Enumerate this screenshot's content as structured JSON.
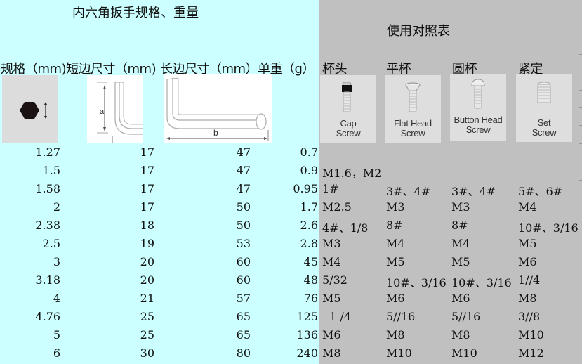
{
  "title": "内六角扳手规格、重量",
  "subtitle": "使用对照表",
  "headers": {
    "spec": "规格（mm)",
    "short": "短边尺寸（mm)",
    "long": "长边尺寸（mm）",
    "weight": "单重（g）",
    "cap": "杯头",
    "flat": "平杯",
    "button": "圆杯",
    "set": "紧定"
  },
  "illustrations": {
    "hex": "hex-key-cross-section",
    "short": {
      "label": "a"
    },
    "long": {
      "label": "b"
    },
    "cap": {
      "line1": "Cap",
      "line2": "Screw"
    },
    "flat": {
      "line1": "Flat Head",
      "line2": "Screw"
    },
    "button": {
      "line1": "Button Head",
      "line2": "Screw"
    },
    "set": {
      "line1": "Set",
      "line2": "Screw"
    }
  },
  "colors": {
    "left_bg": "#CCFFFF",
    "right_bg": "#C0C0C0"
  },
  "rows": [
    {
      "spec": "1.27",
      "short": "17",
      "long": "47",
      "weight": "0.7",
      "cap": "",
      "flat": "",
      "button": "",
      "set": ""
    },
    {
      "spec": "1.5",
      "short": "17",
      "long": "47",
      "weight": "0.9",
      "cap": "M1.6，M2",
      "flat": "",
      "button": "",
      "set": ""
    },
    {
      "spec": "1.58",
      "short": "17",
      "long": "47",
      "weight": "0.95",
      "cap": "1#",
      "flat": "3#、4#",
      "button": "3#、4#",
      "set": "5#、6#"
    },
    {
      "spec": "2",
      "short": "17",
      "long": "50",
      "weight": "1.7",
      "cap": "M2.5",
      "flat": "M3",
      "button": "M3",
      "set": "M4"
    },
    {
      "spec": "2.38",
      "short": "18",
      "long": "50",
      "weight": "2.6",
      "cap": "4#、1/8",
      "flat": "8#",
      "button": "8#",
      "set": "10#、3/16"
    },
    {
      "spec": "2.5",
      "short": "19",
      "long": "53",
      "weight": "2.8",
      "cap": "M3",
      "flat": "M4",
      "button": "M4",
      "set": "M5"
    },
    {
      "spec": "3",
      "short": "20",
      "long": "60",
      "weight": "45",
      "cap": "M4",
      "flat": "M5",
      "button": "M5",
      "set": "M6"
    },
    {
      "spec": "3.18",
      "short": "20",
      "long": "60",
      "weight": "48",
      "cap": "5/32",
      "flat": "10#、3/16",
      "button": "10#、3/16",
      "set": "1//4"
    },
    {
      "spec": "4",
      "short": "21",
      "long": "57",
      "weight": "76",
      "cap": "M5",
      "flat": "M6",
      "button": "M6",
      "set": "M8"
    },
    {
      "spec": "4.76",
      "short": "25",
      "long": "65",
      "weight": "125",
      "cap": "  1 /4",
      "flat": "5//16",
      "button": "5//16",
      "set": "3//8"
    },
    {
      "spec": "5",
      "short": "25",
      "long": "65",
      "weight": "136",
      "cap": "M6",
      "flat": "M8",
      "button": "M8",
      "set": "M10"
    },
    {
      "spec": "6",
      "short": "30",
      "long": "80",
      "weight": "240",
      "cap": "M8",
      "flat": "M10",
      "button": "M10",
      "set": "M12"
    }
  ]
}
